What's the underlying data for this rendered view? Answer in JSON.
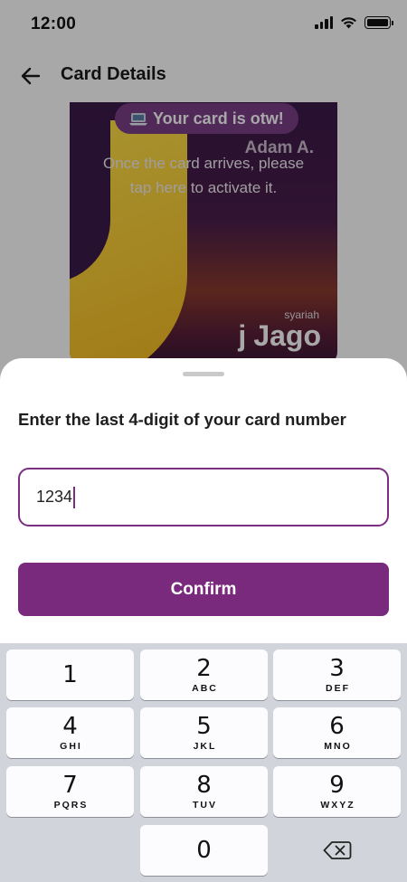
{
  "status_bar": {
    "time": "12:00"
  },
  "app_bar": {
    "title": "Card Details"
  },
  "card": {
    "badge": "Your card is otw!",
    "holder": "Adam A.",
    "activate_line1": "Once the card arrives, please",
    "activate_line2": "tap here to activate it.",
    "brand_sub": "syariah",
    "brand_mark": "ϳ",
    "brand_name": "Jago"
  },
  "sheet": {
    "title": "Enter the last 4-digit of your card number",
    "input_value": "1234",
    "confirm_label": "Confirm"
  },
  "keypad": {
    "keys": [
      {
        "num": "1",
        "letters": ""
      },
      {
        "num": "2",
        "letters": "ABC"
      },
      {
        "num": "3",
        "letters": "DEF"
      },
      {
        "num": "4",
        "letters": "GHI"
      },
      {
        "num": "5",
        "letters": "JKL"
      },
      {
        "num": "6",
        "letters": "MNO"
      },
      {
        "num": "7",
        "letters": "PQRS"
      },
      {
        "num": "8",
        "letters": "TUV"
      },
      {
        "num": "9",
        "letters": "WXYZ"
      },
      {
        "num": "0",
        "letters": ""
      }
    ]
  },
  "colors": {
    "accent": "#7a2a7c",
    "card_dark": "#3b1a49",
    "card_yellow": "#f5c22a"
  }
}
